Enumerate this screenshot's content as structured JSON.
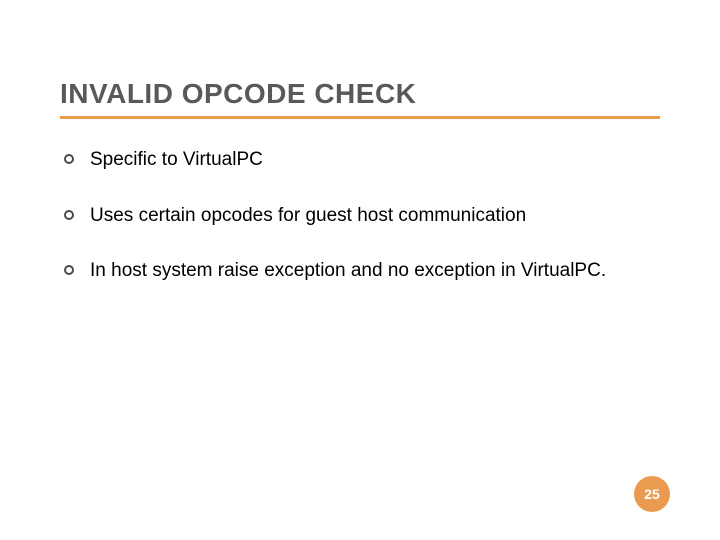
{
  "slide": {
    "title": "INVALID OPCODE CHECK",
    "bullets": [
      "Specific to VirtualPC",
      "Uses certain opcodes for guest host communication",
      "In host system raise exception and no exception in VirtualPC."
    ],
    "page_number": "25"
  },
  "colors": {
    "accent": "#eb9b4f",
    "title_text": "#595959",
    "body_text": "#000000"
  }
}
